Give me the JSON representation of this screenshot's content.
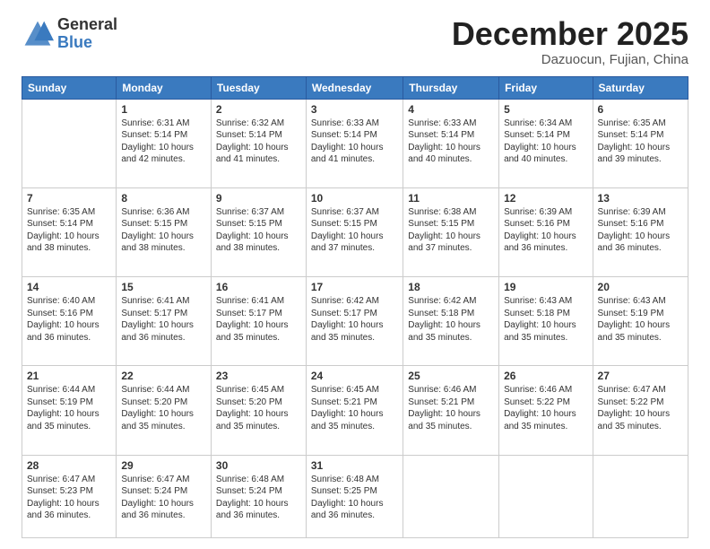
{
  "header": {
    "logo_general": "General",
    "logo_blue": "Blue",
    "month_title": "December 2025",
    "subtitle": "Dazuocun, Fujian, China"
  },
  "days_of_week": [
    "Sunday",
    "Monday",
    "Tuesday",
    "Wednesday",
    "Thursday",
    "Friday",
    "Saturday"
  ],
  "weeks": [
    [
      {
        "day": "",
        "sunrise": "",
        "sunset": "",
        "daylight": ""
      },
      {
        "day": "1",
        "sunrise": "Sunrise: 6:31 AM",
        "sunset": "Sunset: 5:14 PM",
        "daylight": "Daylight: 10 hours and 42 minutes."
      },
      {
        "day": "2",
        "sunrise": "Sunrise: 6:32 AM",
        "sunset": "Sunset: 5:14 PM",
        "daylight": "Daylight: 10 hours and 41 minutes."
      },
      {
        "day": "3",
        "sunrise": "Sunrise: 6:33 AM",
        "sunset": "Sunset: 5:14 PM",
        "daylight": "Daylight: 10 hours and 41 minutes."
      },
      {
        "day": "4",
        "sunrise": "Sunrise: 6:33 AM",
        "sunset": "Sunset: 5:14 PM",
        "daylight": "Daylight: 10 hours and 40 minutes."
      },
      {
        "day": "5",
        "sunrise": "Sunrise: 6:34 AM",
        "sunset": "Sunset: 5:14 PM",
        "daylight": "Daylight: 10 hours and 40 minutes."
      },
      {
        "day": "6",
        "sunrise": "Sunrise: 6:35 AM",
        "sunset": "Sunset: 5:14 PM",
        "daylight": "Daylight: 10 hours and 39 minutes."
      }
    ],
    [
      {
        "day": "7",
        "sunrise": "Sunrise: 6:35 AM",
        "sunset": "Sunset: 5:14 PM",
        "daylight": "Daylight: 10 hours and 38 minutes."
      },
      {
        "day": "8",
        "sunrise": "Sunrise: 6:36 AM",
        "sunset": "Sunset: 5:15 PM",
        "daylight": "Daylight: 10 hours and 38 minutes."
      },
      {
        "day": "9",
        "sunrise": "Sunrise: 6:37 AM",
        "sunset": "Sunset: 5:15 PM",
        "daylight": "Daylight: 10 hours and 38 minutes."
      },
      {
        "day": "10",
        "sunrise": "Sunrise: 6:37 AM",
        "sunset": "Sunset: 5:15 PM",
        "daylight": "Daylight: 10 hours and 37 minutes."
      },
      {
        "day": "11",
        "sunrise": "Sunrise: 6:38 AM",
        "sunset": "Sunset: 5:15 PM",
        "daylight": "Daylight: 10 hours and 37 minutes."
      },
      {
        "day": "12",
        "sunrise": "Sunrise: 6:39 AM",
        "sunset": "Sunset: 5:16 PM",
        "daylight": "Daylight: 10 hours and 36 minutes."
      },
      {
        "day": "13",
        "sunrise": "Sunrise: 6:39 AM",
        "sunset": "Sunset: 5:16 PM",
        "daylight": "Daylight: 10 hours and 36 minutes."
      }
    ],
    [
      {
        "day": "14",
        "sunrise": "Sunrise: 6:40 AM",
        "sunset": "Sunset: 5:16 PM",
        "daylight": "Daylight: 10 hours and 36 minutes."
      },
      {
        "day": "15",
        "sunrise": "Sunrise: 6:41 AM",
        "sunset": "Sunset: 5:17 PM",
        "daylight": "Daylight: 10 hours and 36 minutes."
      },
      {
        "day": "16",
        "sunrise": "Sunrise: 6:41 AM",
        "sunset": "Sunset: 5:17 PM",
        "daylight": "Daylight: 10 hours and 35 minutes."
      },
      {
        "day": "17",
        "sunrise": "Sunrise: 6:42 AM",
        "sunset": "Sunset: 5:17 PM",
        "daylight": "Daylight: 10 hours and 35 minutes."
      },
      {
        "day": "18",
        "sunrise": "Sunrise: 6:42 AM",
        "sunset": "Sunset: 5:18 PM",
        "daylight": "Daylight: 10 hours and 35 minutes."
      },
      {
        "day": "19",
        "sunrise": "Sunrise: 6:43 AM",
        "sunset": "Sunset: 5:18 PM",
        "daylight": "Daylight: 10 hours and 35 minutes."
      },
      {
        "day": "20",
        "sunrise": "Sunrise: 6:43 AM",
        "sunset": "Sunset: 5:19 PM",
        "daylight": "Daylight: 10 hours and 35 minutes."
      }
    ],
    [
      {
        "day": "21",
        "sunrise": "Sunrise: 6:44 AM",
        "sunset": "Sunset: 5:19 PM",
        "daylight": "Daylight: 10 hours and 35 minutes."
      },
      {
        "day": "22",
        "sunrise": "Sunrise: 6:44 AM",
        "sunset": "Sunset: 5:20 PM",
        "daylight": "Daylight: 10 hours and 35 minutes."
      },
      {
        "day": "23",
        "sunrise": "Sunrise: 6:45 AM",
        "sunset": "Sunset: 5:20 PM",
        "daylight": "Daylight: 10 hours and 35 minutes."
      },
      {
        "day": "24",
        "sunrise": "Sunrise: 6:45 AM",
        "sunset": "Sunset: 5:21 PM",
        "daylight": "Daylight: 10 hours and 35 minutes."
      },
      {
        "day": "25",
        "sunrise": "Sunrise: 6:46 AM",
        "sunset": "Sunset: 5:21 PM",
        "daylight": "Daylight: 10 hours and 35 minutes."
      },
      {
        "day": "26",
        "sunrise": "Sunrise: 6:46 AM",
        "sunset": "Sunset: 5:22 PM",
        "daylight": "Daylight: 10 hours and 35 minutes."
      },
      {
        "day": "27",
        "sunrise": "Sunrise: 6:47 AM",
        "sunset": "Sunset: 5:22 PM",
        "daylight": "Daylight: 10 hours and 35 minutes."
      }
    ],
    [
      {
        "day": "28",
        "sunrise": "Sunrise: 6:47 AM",
        "sunset": "Sunset: 5:23 PM",
        "daylight": "Daylight: 10 hours and 36 minutes."
      },
      {
        "day": "29",
        "sunrise": "Sunrise: 6:47 AM",
        "sunset": "Sunset: 5:24 PM",
        "daylight": "Daylight: 10 hours and 36 minutes."
      },
      {
        "day": "30",
        "sunrise": "Sunrise: 6:48 AM",
        "sunset": "Sunset: 5:24 PM",
        "daylight": "Daylight: 10 hours and 36 minutes."
      },
      {
        "day": "31",
        "sunrise": "Sunrise: 6:48 AM",
        "sunset": "Sunset: 5:25 PM",
        "daylight": "Daylight: 10 hours and 36 minutes."
      },
      {
        "day": "",
        "sunrise": "",
        "sunset": "",
        "daylight": ""
      },
      {
        "day": "",
        "sunrise": "",
        "sunset": "",
        "daylight": ""
      },
      {
        "day": "",
        "sunrise": "",
        "sunset": "",
        "daylight": ""
      }
    ]
  ]
}
